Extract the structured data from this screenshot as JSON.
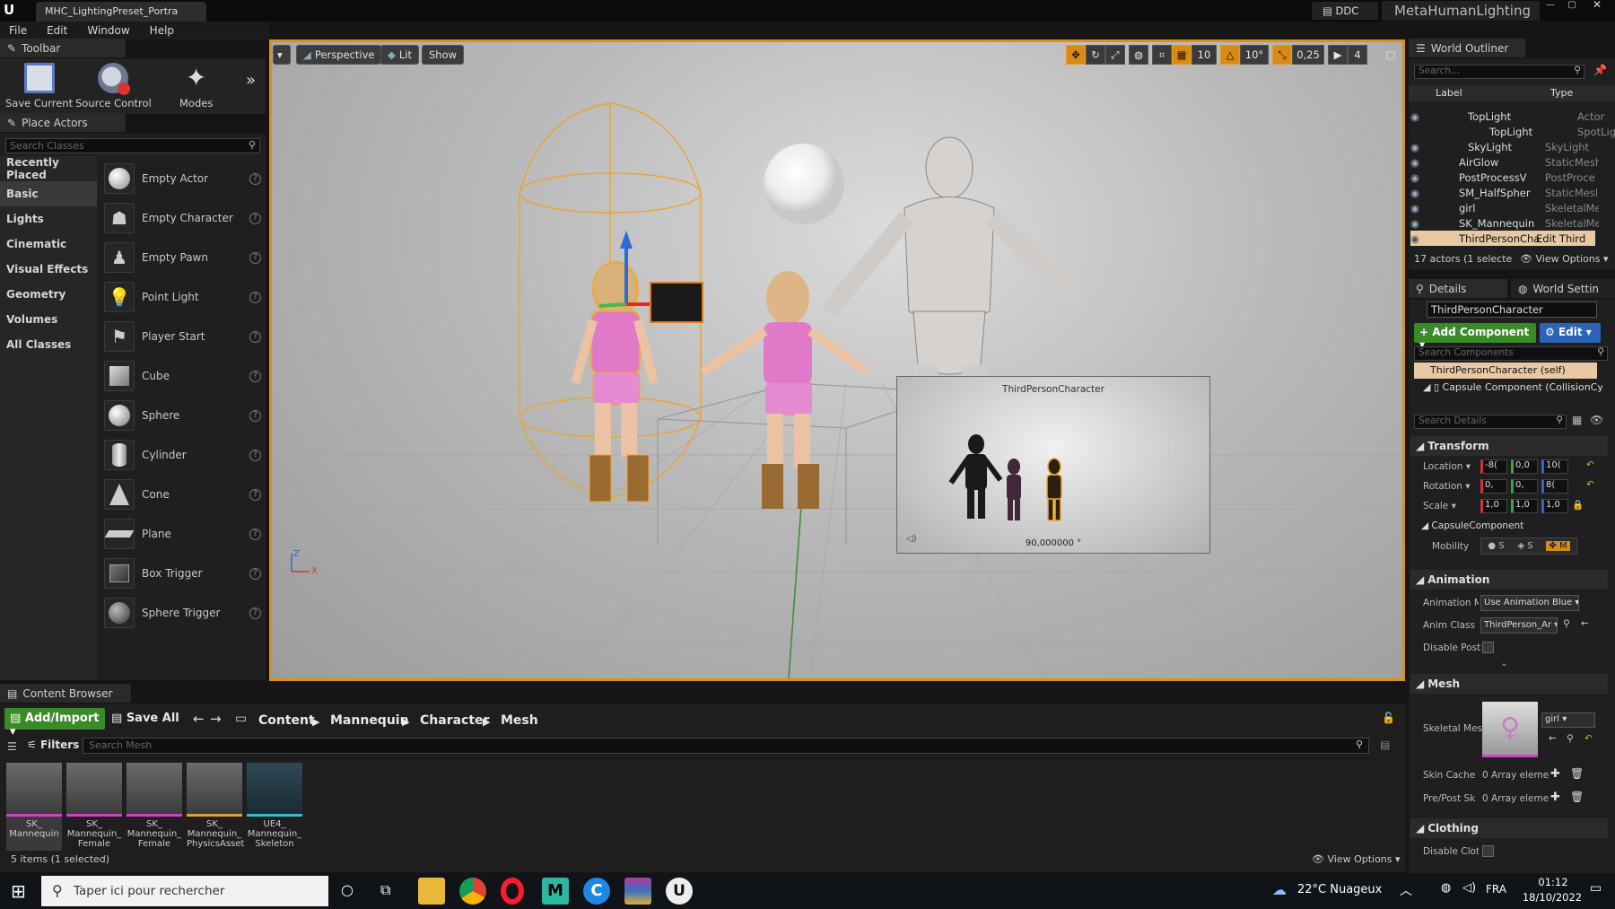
{
  "window": {
    "tab_title": "MHC_LightingPreset_Portra",
    "ddc_label": "DDC",
    "project_name": "MetaHumanLighting"
  },
  "menu": [
    "File",
    "Edit",
    "Window",
    "Help"
  ],
  "toolbar": {
    "title": "Toolbar",
    "save_label": "Save Current",
    "source_label": "Source Control",
    "modes_label": "Modes"
  },
  "place_actors": {
    "title": "Place Actors",
    "search_placeholder": "Search Classes",
    "categories": [
      "Recently Placed",
      "Basic",
      "Lights",
      "Cinematic",
      "Visual Effects",
      "Geometry",
      "Volumes",
      "All Classes"
    ],
    "items": [
      "Empty Actor",
      "Empty Character",
      "Empty Pawn",
      "Point Light",
      "Player Start",
      "Cube",
      "Sphere",
      "Cylinder",
      "Cone",
      "Plane",
      "Box Trigger",
      "Sphere Trigger"
    ]
  },
  "viewport": {
    "perspective": "Perspective",
    "lit": "Lit",
    "show": "Show",
    "grid_snap": "10",
    "rot_snap": "10°",
    "scale_snap": "0,25",
    "cam_speed": "4",
    "axis_z": "Z",
    "axis_x": "X",
    "pip_title": "ThirdPersonCharacter",
    "pip_fov": "90,000000 °"
  },
  "outliner": {
    "title": "World Outliner",
    "search_placeholder": "Search...",
    "col_label": "Label",
    "col_type": "Type",
    "rows": [
      {
        "label": "TopLight",
        "type": "Actor"
      },
      {
        "label": "TopLight",
        "type": "SpotLight"
      },
      {
        "label": "SkyLight",
        "type": "SkyLight"
      },
      {
        "label": "AirGlow",
        "type": "StaticMesh"
      },
      {
        "label": "PostProcessV",
        "type": "PostProce"
      },
      {
        "label": "SM_HalfSpher",
        "type": "StaticMesl"
      },
      {
        "label": "girl",
        "type": "SkeletalMe"
      },
      {
        "label": "SK_Mannequin",
        "type": "SkeletalMe"
      },
      {
        "label": "ThirdPersonCha",
        "type": "Edit Third"
      }
    ],
    "status": "17 actors (1 selecte",
    "view_options": "View Options"
  },
  "details": {
    "tab": "Details",
    "tab2": "World Settin",
    "actor_name": "ThirdPersonCharacter",
    "add_component": "Add Component",
    "edit": "Edit",
    "components_search": "Search Components",
    "comp_self": "ThirdPersonCharacter (self)",
    "comp_capsule": "Capsule Component (CollisionCyl",
    "details_search": "Search Details",
    "transform": "Transform",
    "location": "Location",
    "rotation": "Rotation",
    "scale": "Scale",
    "loc_vals": [
      "-8(",
      "0,0",
      "10("
    ],
    "rot_vals": [
      "0,",
      "0,",
      "8("
    ],
    "scale_vals": [
      "1,0",
      "1,0",
      "1,0"
    ],
    "capsule_sub": "CapsuleComponent",
    "mobility": "Mobility",
    "animation": "Animation",
    "anim_mode": "Animation M",
    "anim_mode_val": "Use Animation Blue",
    "anim_class": "Anim Class",
    "anim_class_val": "ThirdPerson_Ar",
    "disable_post": "Disable Post",
    "mesh": "Mesh",
    "skeletal_mesh": "Skeletal Mes",
    "mesh_val": "girl",
    "skin_cache": "Skin Cache U",
    "skin_cache_val": "0 Array eleme",
    "prepost": "Pre/Post Sk",
    "prepost_val": "0 Array eleme",
    "clothing": "Clothing",
    "disable_cloth": "Disable Clotl"
  },
  "content_browser": {
    "title": "Content Browser",
    "add_import": "Add/Import",
    "save_all": "Save All",
    "path": [
      "Content",
      "Mannequin",
      "Character",
      "Mesh"
    ],
    "filters": "Filters",
    "search_placeholder": "Search Mesh",
    "assets": [
      "SK_ Mannequin",
      "SK_ Mannequin_ Female",
      "SK_ Mannequin_ Female",
      "SK_ Mannequin_ PhysicsAsset",
      "UE4_ Mannequin_ Skeleton"
    ],
    "status": "5 items (1 selected)",
    "view_options": "View Options"
  },
  "taskbar": {
    "search": "Taper ici pour rechercher",
    "weather": "22°C  Nuageux",
    "lang": "FRA",
    "time": "01:12",
    "date": "18/10/2022"
  }
}
